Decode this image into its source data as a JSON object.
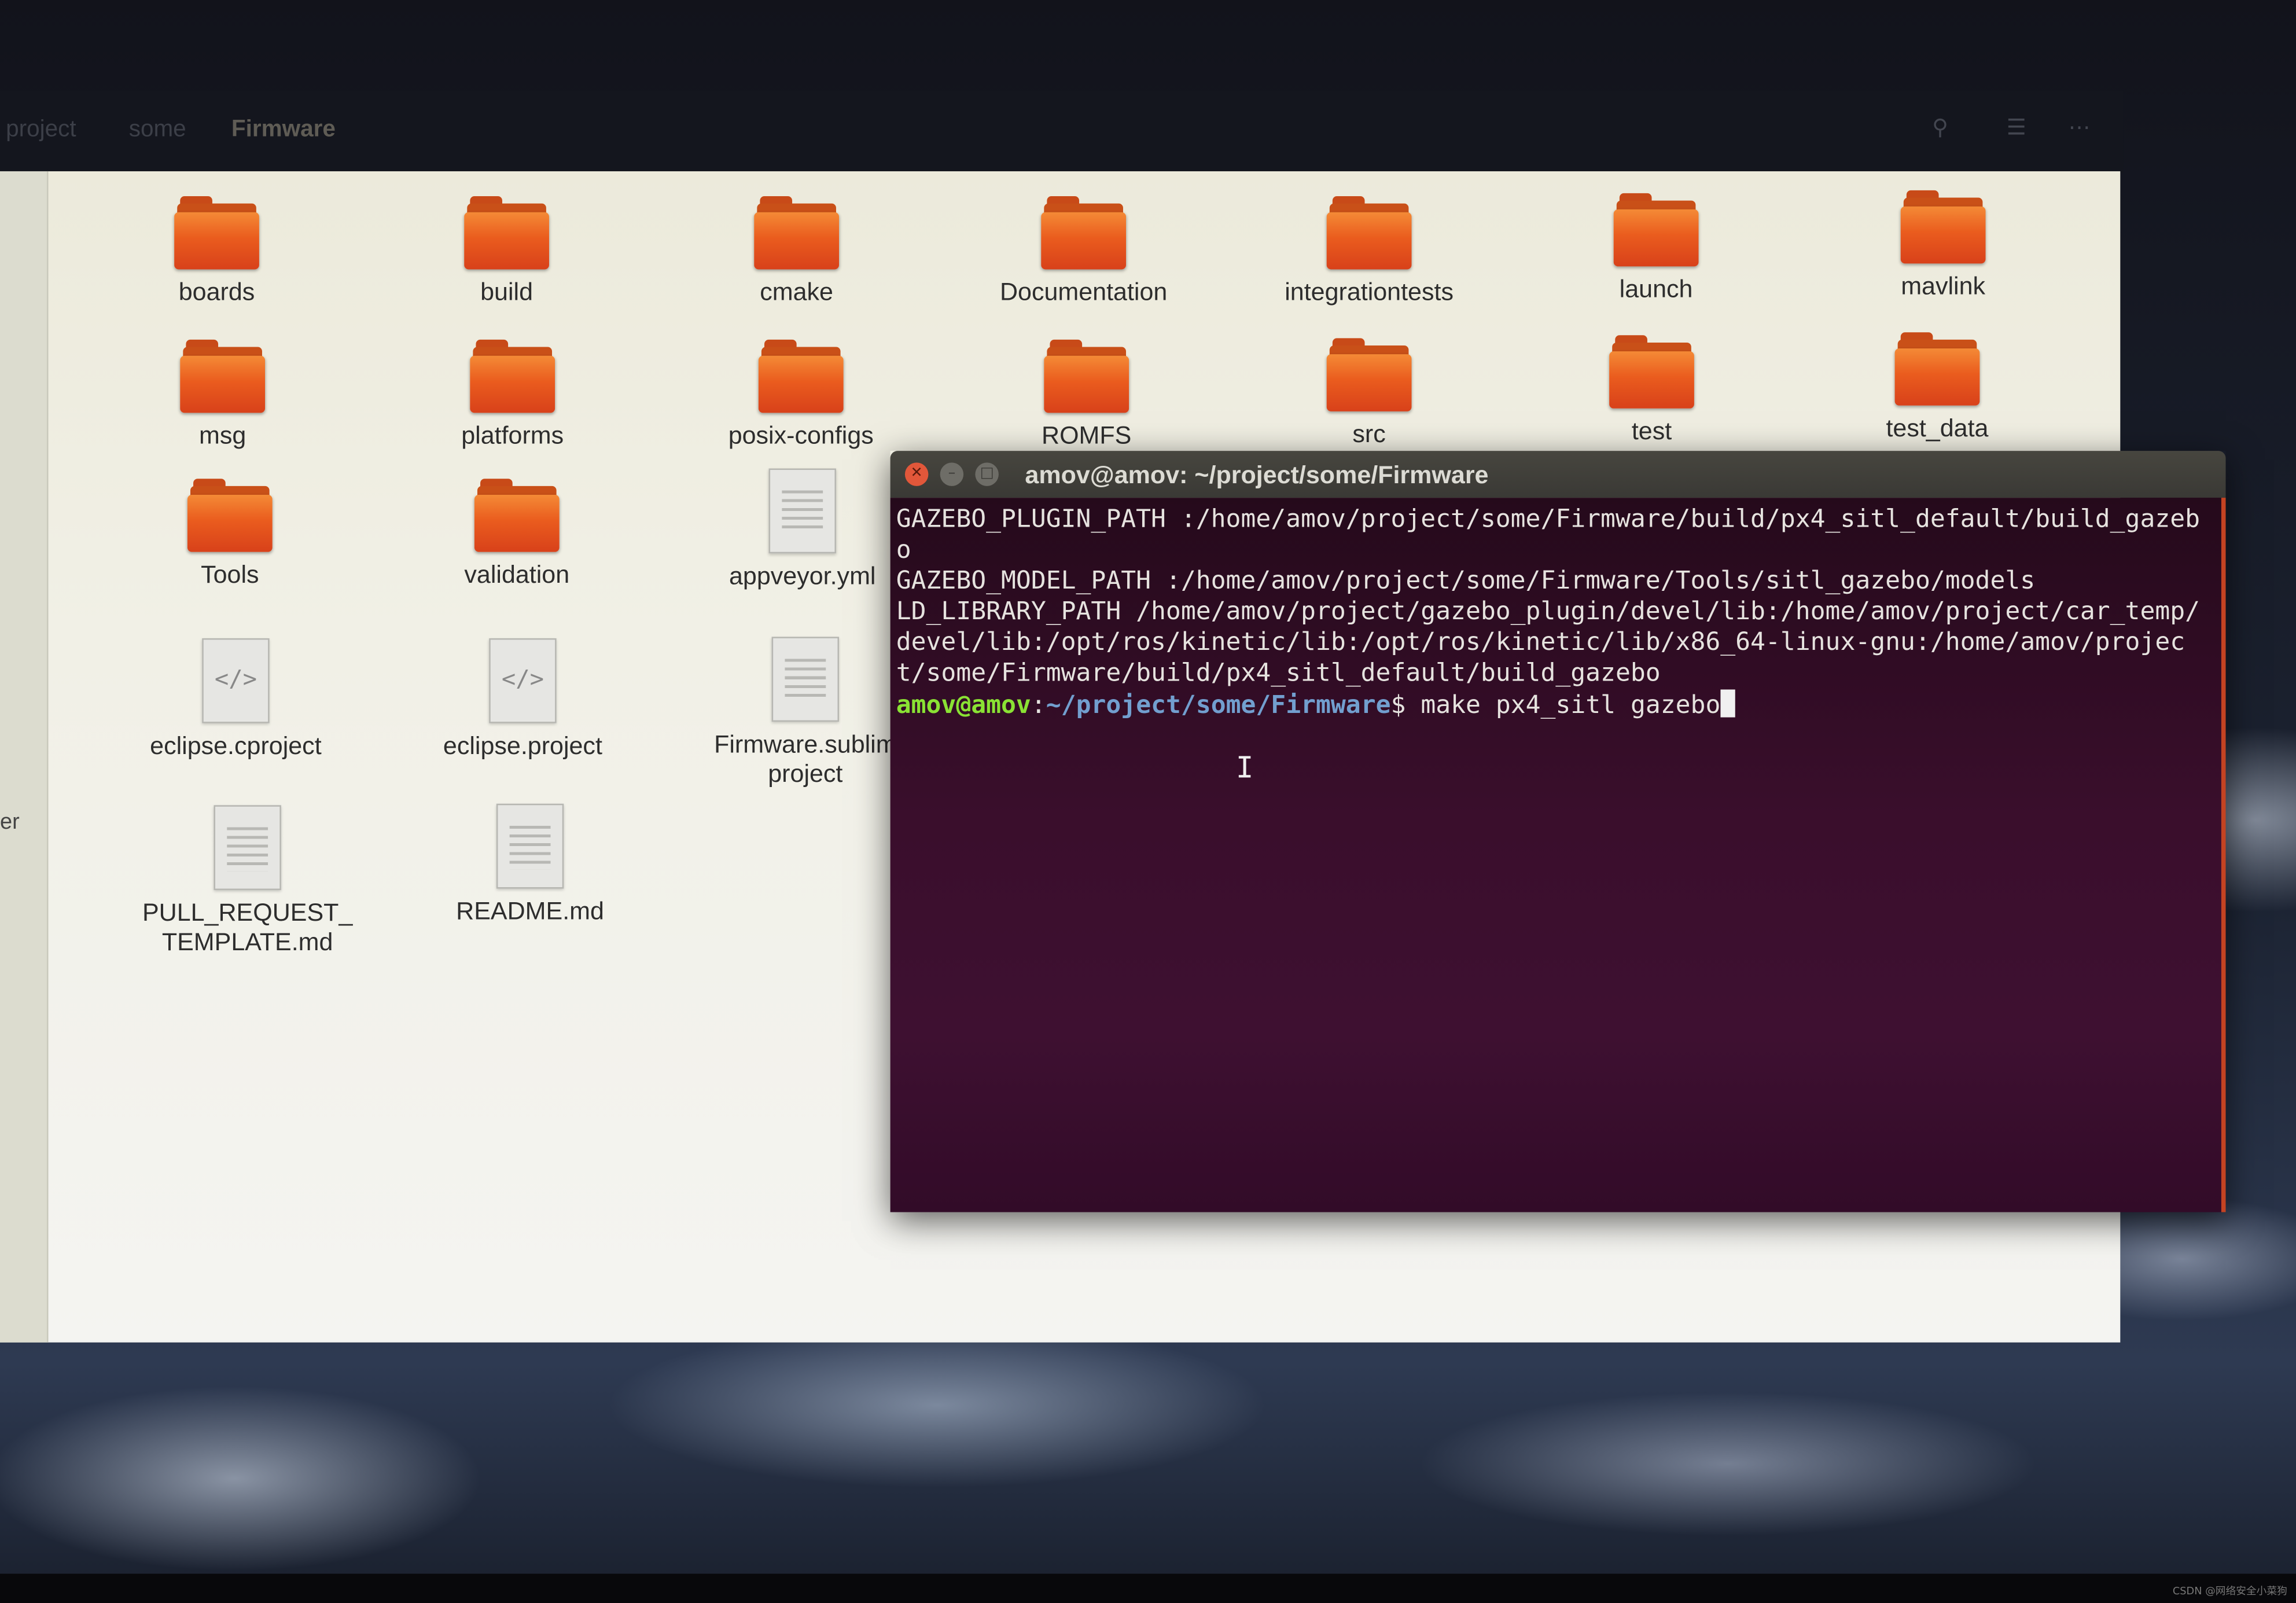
{
  "breadcrumb": [
    "project",
    "some",
    "Firmware"
  ],
  "sidebar_partial_label": "er",
  "files": [
    {
      "name": "boards",
      "kind": "folder"
    },
    {
      "name": "build",
      "kind": "folder"
    },
    {
      "name": "cmake",
      "kind": "folder"
    },
    {
      "name": "Documentation",
      "kind": "folder"
    },
    {
      "name": "integrationtests",
      "kind": "folder"
    },
    {
      "name": "launch",
      "kind": "folder"
    },
    {
      "name": "mavlink",
      "kind": "folder"
    },
    {
      "name": "msg",
      "kind": "folder"
    },
    {
      "name": "platforms",
      "kind": "folder"
    },
    {
      "name": "posix-configs",
      "kind": "folder"
    },
    {
      "name": "ROMFS",
      "kind": "folder"
    },
    {
      "name": "src",
      "kind": "folder"
    },
    {
      "name": "test",
      "kind": "folder"
    },
    {
      "name": "test_data",
      "kind": "folder"
    },
    {
      "name": "Tools",
      "kind": "folder"
    },
    {
      "name": "validation",
      "kind": "folder"
    },
    {
      "name": "appveyor.yml",
      "kind": "text-file"
    },
    {
      "name": "eclipse.cproject",
      "kind": "code-file"
    },
    {
      "name": "eclipse.project",
      "kind": "code-file"
    },
    {
      "name": "Firmware.sublim\nproject",
      "kind": "text-file"
    },
    {
      "name": "PULL_REQUEST_\nTEMPLATE.md",
      "kind": "text-file"
    },
    {
      "name": "README.md",
      "kind": "text-file"
    }
  ],
  "terminal": {
    "title": "amov@amov: ~/project/some/Firmware",
    "output": "GAZEBO_PLUGIN_PATH :/home/amov/project/some/Firmware/build/px4_sitl_default/build_gazebo\nGAZEBO_MODEL_PATH :/home/amov/project/some/Firmware/Tools/sitl_gazebo/models\nLD_LIBRARY_PATH /home/amov/project/gazebo_plugin/devel/lib:/home/amov/project/car_temp/devel/lib:/opt/ros/kinetic/lib:/opt/ros/kinetic/lib/x86_64-linux-gnu:/home/amov/project/some/Firmware/build/px4_sitl_default/build_gazebo",
    "prompt_user": "amov@amov",
    "prompt_sep": ":",
    "prompt_path": "~/project/some/Firmware",
    "prompt_symbol": "$ ",
    "command": "make px4_sitl gazebo"
  },
  "icons": [
    "search-icon",
    "list-view-icon",
    "grid-view-icon",
    "close-icon",
    "minimize-icon",
    "maximize-icon",
    "folder-icon",
    "text-file-icon",
    "code-file-icon"
  ],
  "watermark": "CSDN @网络安全小菜狗",
  "colors": {
    "folder": "#ea5c1e",
    "terminal_bg": "#3a0e2c",
    "prompt_user": "#8ae234",
    "prompt_path": "#729fcf"
  }
}
